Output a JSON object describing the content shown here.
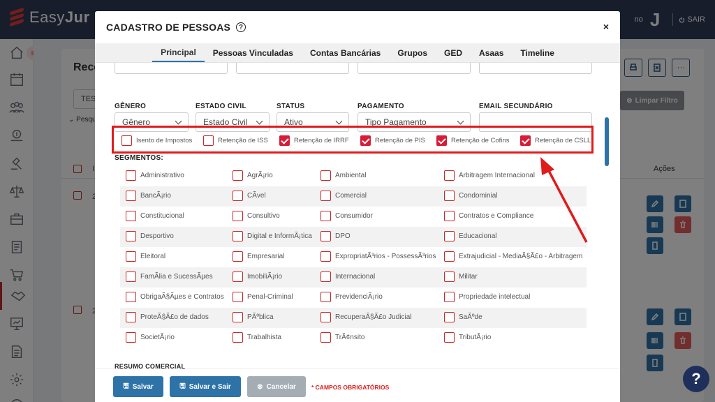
{
  "app": {
    "brand_first": "Easy",
    "brand_second": "Jur",
    "user_initial": "J",
    "user_text": "no",
    "logout_label": "SAIR",
    "brand_color": "#e63b3b",
    "topbar_color": "#2f3a57"
  },
  "background": {
    "page_title": "Rece",
    "select_value": "TES",
    "search_toggle": "Pesqu",
    "clear_filter_label": "Limpar Filtro",
    "col_i": "I",
    "actions_header": "Ações",
    "row_num_1": "2",
    "row_num_2": "2"
  },
  "modal": {
    "title": "CADASTRO DE PESSOAS",
    "close_label": "×",
    "tabs": [
      "Principal",
      "Pessoas Vinculadas",
      "Contas Bancárias",
      "Grupos",
      "GED",
      "Asaas",
      "Timeline"
    ],
    "active_tab": "Principal",
    "fields": {
      "genero_label": "GÊNERO",
      "genero_value": "Gênero",
      "estado_civil_label": "ESTADO CIVIL",
      "estado_civil_value": "Estado Civil",
      "status_label": "STATUS",
      "status_value": "Ativo",
      "pagamento_label": "PAGAMENTO",
      "pagamento_value": "Tipo Pagamento",
      "email_secundario_label": "EMAIL SECUNDÁRIO",
      "email_secundario_value": ""
    },
    "retencoes": [
      {
        "label": "Isento de Impostos",
        "checked": false
      },
      {
        "label": "Retenção de ISS",
        "checked": false
      },
      {
        "label": "Retenção de IRRF",
        "checked": true
      },
      {
        "label": "Retenção de PIS",
        "checked": true
      },
      {
        "label": "Retenção de Cofins",
        "checked": true
      },
      {
        "label": "Retenção de CSLL",
        "checked": true
      }
    ],
    "segmentos_title": "SEGMENTOS:",
    "segmentos": [
      [
        "Administrativo",
        "AgrÃ¡rio",
        "Ambiental",
        "Arbitragem Internacional"
      ],
      [
        "BancÃ¡rio",
        "CÃvel",
        "Comercial",
        "Condominial"
      ],
      [
        "Constitucional",
        "Consultivo",
        "Consumidor",
        "Contratos e Compliance"
      ],
      [
        "Desportivo",
        "Digital e InformÃ¡tica",
        "DPO",
        "Educacional"
      ],
      [
        "Eleitoral",
        "Empresarial",
        "ExpropriatÃ³rios - PossessÃ³rios",
        "Extrajudicial - MediaÃ§Ã£o - Arbitragem"
      ],
      [
        "FamÃlia e SucessÃµes",
        "ImobiliÃ¡rio",
        "Internacional",
        "Militar"
      ],
      [
        "ObrigaÃ§Ãµes e Contratos",
        "Penal-Criminal",
        "PrevidenciÃ¡rio",
        "Propriedade intelectual"
      ],
      [
        "ProteÃ§Ã£o de dados",
        "PÃºblica",
        "RecuperaÃ§Ã£o Judicial",
        "SaÃºde"
      ],
      [
        "SocietÃ¡rio",
        "Trabalhista",
        "TrÃ¢nsito",
        "TributÃ¡rio"
      ]
    ],
    "resumo_title": "RESUMO COMERCIAL",
    "buttons": {
      "save": "Salvar",
      "save_exit": "Salvar e Sair",
      "cancel": "Cancelar"
    },
    "required_note": "* CAMPOS OBRIGATÓRIOS"
  },
  "help_fab": "?"
}
